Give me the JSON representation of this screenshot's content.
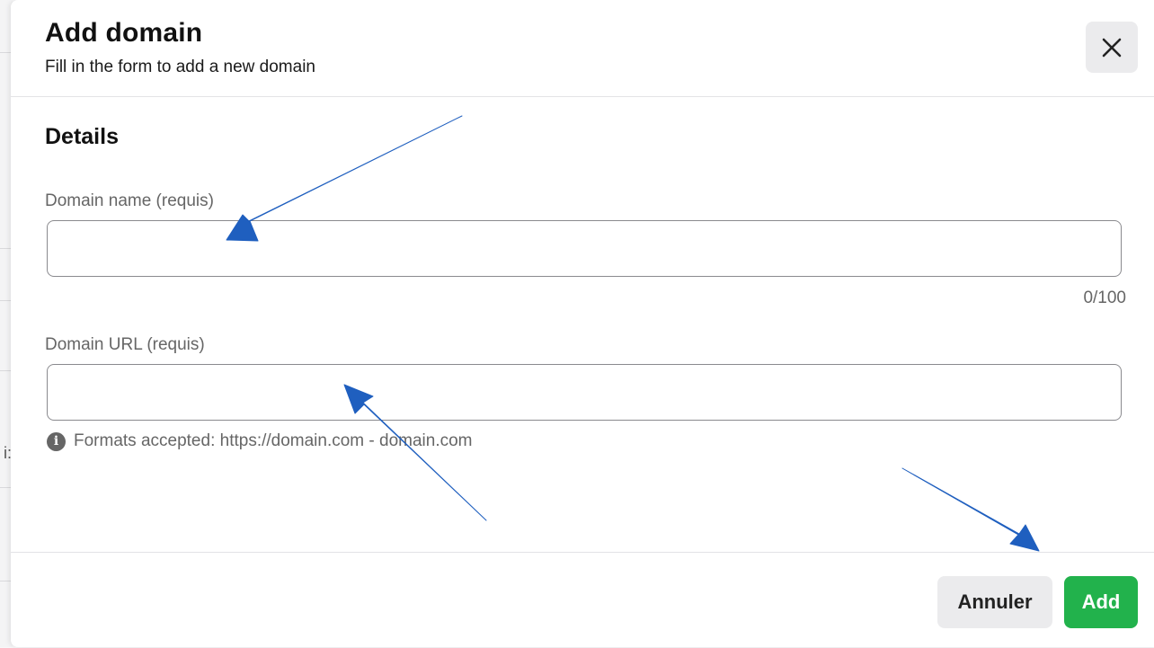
{
  "modal": {
    "title": "Add domain",
    "subtitle": "Fill in the form to add a new domain",
    "close_icon": "close-icon"
  },
  "details": {
    "section_title": "Details",
    "domain_name": {
      "label": "Domain name (requis)",
      "value": "",
      "counter": "0/100"
    },
    "domain_url": {
      "label": "Domain URL (requis)",
      "value": "",
      "hint": "Formats accepted: https://domain.com - domain.com",
      "hint_icon": "info-icon"
    }
  },
  "footer": {
    "cancel_label": "Annuler",
    "add_label": "Add"
  },
  "background": {
    "partial_char": "i:"
  },
  "colors": {
    "accent_green": "#22b24c",
    "arrow_blue": "#1f5fbf"
  }
}
